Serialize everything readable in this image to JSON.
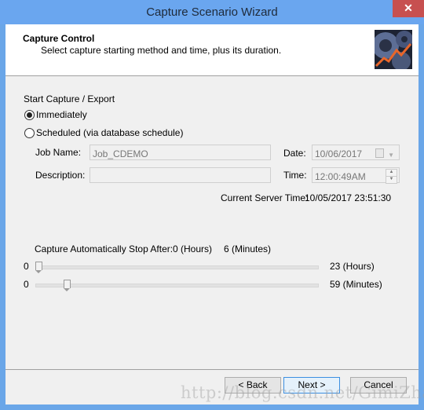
{
  "window": {
    "title": "Capture Scenario Wizard",
    "close_icon": "✕"
  },
  "header": {
    "title": "Capture Control",
    "subtitle": "Select capture starting method and time, plus its duration.",
    "logo_icon": "gears-chart-icon"
  },
  "start": {
    "group_label": "Start Capture / Export",
    "options": [
      {
        "label": "Immediately",
        "checked": true
      },
      {
        "label": "Scheduled (via database schedule)",
        "checked": false
      }
    ],
    "job_name_label": "Job Name:",
    "job_name_value": "Job_CDEMO",
    "description_label": "Description:",
    "description_value": "",
    "date_label": "Date:",
    "date_value": "10/06/2017",
    "time_label": "Time:",
    "time_value": "12:00:49AM",
    "server_time_label": "Current Server Time:",
    "server_time_value": "10/05/2017 23:51:30"
  },
  "stop": {
    "label": "Capture Automatically Stop After:",
    "hours_text": "0 (Hours)",
    "minutes_text": "6 (Minutes)",
    "hours_slider": {
      "min": 0,
      "max": 23,
      "value": 0,
      "min_label": "0",
      "max_label": "23 (Hours)"
    },
    "minutes_slider": {
      "min": 0,
      "max": 59,
      "value": 6,
      "min_label": "0",
      "max_label": "59 (Minutes)"
    }
  },
  "buttons": {
    "back": "< Back",
    "next": "Next >",
    "cancel": "Cancel"
  },
  "watermark": "http://blog.csdn.net/GimiZhang"
}
